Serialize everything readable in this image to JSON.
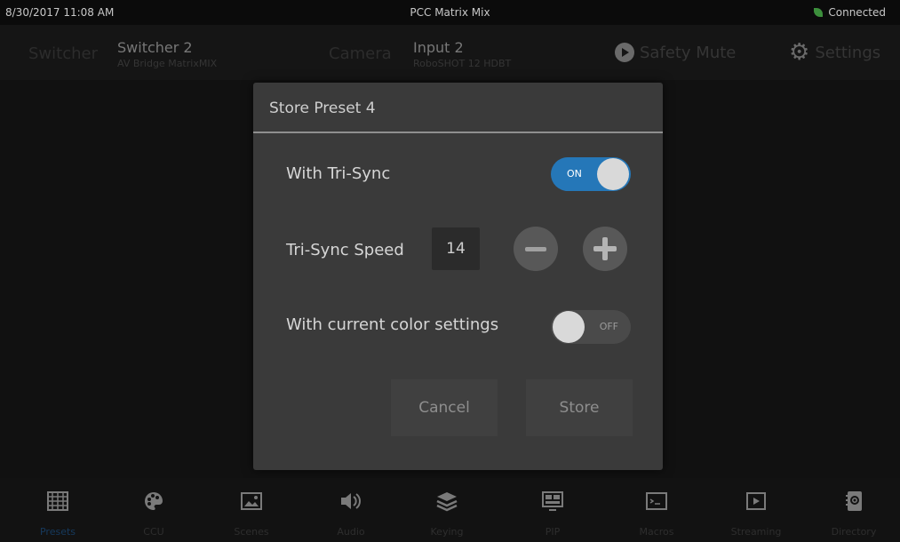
{
  "status": {
    "datetime": "8/30/2017 11:08 AM",
    "title": "PCC Matrix Mix",
    "connection": "Connected",
    "connection_color": "#3c8f3c"
  },
  "header": {
    "switcher_label": "Switcher",
    "switcher_name": "Switcher 2",
    "switcher_model": "AV Bridge MatrixMIX",
    "camera_label": "Camera",
    "camera_name": "Input 2",
    "camera_model": "RoboSHOT 12 HDBT",
    "safety_mute_label": "Safety Mute",
    "settings_label": "Settings"
  },
  "dialog": {
    "title": "Store Preset 4",
    "with_trisync_label": "With Tri-Sync",
    "with_trisync_state": "ON",
    "trisync_speed_label": "Tri-Sync Speed",
    "trisync_speed_value": "14",
    "color_settings_label": "With current color settings",
    "color_settings_state": "OFF",
    "cancel_label": "Cancel",
    "store_label": "Store",
    "accent_color": "#2577b8"
  },
  "nav": {
    "items": [
      {
        "label": "Presets",
        "icon": "grid-icon",
        "active": true
      },
      {
        "label": "CCU",
        "icon": "palette-icon"
      },
      {
        "label": "Scenes",
        "icon": "picture-icon"
      },
      {
        "label": "Audio",
        "icon": "speaker-icon"
      },
      {
        "label": "Keying",
        "icon": "layers-icon"
      },
      {
        "label": "PIP",
        "icon": "pip-icon"
      },
      {
        "label": "Macros",
        "icon": "terminal-icon"
      },
      {
        "label": "Streaming",
        "icon": "play-icon"
      },
      {
        "label": "Directory",
        "icon": "contacts-icon"
      }
    ]
  }
}
